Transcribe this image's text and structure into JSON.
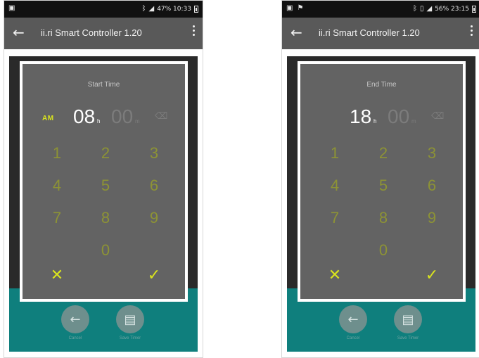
{
  "app": {
    "title": "ii.ri Smart Controller 1.20",
    "back_icon": "arrow-left-icon",
    "menu_icon": "more-vert-icon"
  },
  "colors": {
    "app_bar": "#595959",
    "accent_yellow": "#d9e31e",
    "keypad_digit": "#8d9335",
    "dialog_bg": "#636363",
    "teal": "#0f7f7d"
  },
  "icons": {
    "backspace": "⌫",
    "cancel": "✕",
    "ok": "✓",
    "back_circle": "←",
    "save_circle": "💾"
  },
  "keypad": {
    "keys": [
      "1",
      "2",
      "3",
      "4",
      "5",
      "6",
      "7",
      "8",
      "9",
      "0"
    ]
  },
  "screens": [
    {
      "statusbar": {
        "text": "47% 10:33"
      },
      "dialog": {
        "title": "Start Time",
        "ampm": "AM",
        "hour": "08",
        "hour_unit": "h",
        "minute": "00",
        "minute_unit": "m"
      },
      "bottom": {
        "btn1_caption": "Cancel",
        "btn2_caption": "Save Timer"
      }
    },
    {
      "statusbar": {
        "text": "56% 23:15"
      },
      "dialog": {
        "title": "End Time",
        "ampm": "",
        "hour": "18",
        "hour_unit": "h",
        "minute": "00",
        "minute_unit": "m"
      },
      "bottom": {
        "btn1_caption": "Cancel",
        "btn2_caption": "Save Timer"
      }
    }
  ]
}
